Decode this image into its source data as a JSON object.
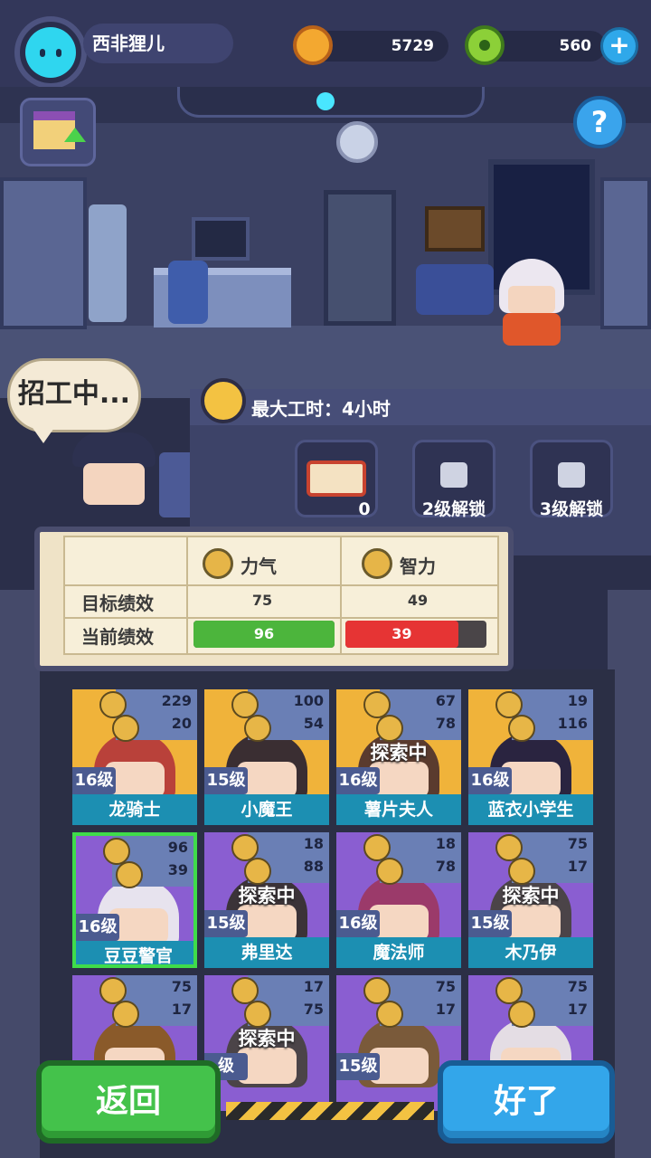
{
  "player": {
    "name": "西非狸儿",
    "coins": "5729",
    "donuts": "560"
  },
  "recruit": {
    "bubble": "招工中..."
  },
  "work": {
    "max_hours": "最大工时：4小时",
    "slot_count": "0",
    "slot2": "2级解锁",
    "slot3": "3级解锁"
  },
  "stats": {
    "col_strength": "力气",
    "col_intellect": "智力",
    "row_target": "目标绩效",
    "row_current": "当前绩效",
    "target_strength": "75",
    "target_intellect": "49",
    "current_strength": "96",
    "current_intellect": "39",
    "strength_fill": 1.0,
    "intellect_fill": 0.8
  },
  "roster": [
    {
      "name": "龙骑士",
      "level": "16级",
      "str": "229",
      "int": "20",
      "exploring": ""
    },
    {
      "name": "小魔王",
      "level": "15级",
      "str": "100",
      "int": "54",
      "exploring": ""
    },
    {
      "name": "薯片夫人",
      "level": "16级",
      "str": "67",
      "int": "78",
      "exploring": "探索中"
    },
    {
      "name": "蓝衣小学生",
      "level": "16级",
      "str": "19",
      "int": "116",
      "exploring": ""
    },
    {
      "name": "豆豆警官",
      "level": "16级",
      "str": "96",
      "int": "39",
      "exploring": ""
    },
    {
      "name": "弗里达",
      "level": "15级",
      "str": "18",
      "int": "88",
      "exploring": "探索中"
    },
    {
      "name": "魔法师",
      "level": "16级",
      "str": "18",
      "int": "78",
      "exploring": ""
    },
    {
      "name": "木乃伊",
      "level": "15级",
      "str": "75",
      "int": "17",
      "exploring": "探索中"
    },
    {
      "name": "",
      "level": "",
      "str": "75",
      "int": "17",
      "exploring": ""
    },
    {
      "name": "",
      "level": "级",
      "str": "17",
      "int": "75",
      "exploring": "探索中"
    },
    {
      "name": "",
      "level": "15级",
      "str": "75",
      "int": "17",
      "exploring": ""
    },
    {
      "name": "",
      "level": "",
      "str": "75",
      "int": "17",
      "exploring": ""
    }
  ],
  "buttons": {
    "back": "返回",
    "ok": "好了"
  },
  "colors": {
    "strength_bar": "#4cb53c",
    "intellect_bar": "#e63434",
    "back_button": "#44c24b",
    "ok_button": "#33a6ea",
    "name_bar": "#1c8fb2"
  },
  "icons": [
    "cat-avatar-icon",
    "coin-icon",
    "donut-icon",
    "plus-icon",
    "shop-upgrade-icon",
    "help-icon",
    "clock-icon",
    "lunchbox-icon",
    "lock-icon",
    "muscle-icon",
    "brain-icon"
  ]
}
